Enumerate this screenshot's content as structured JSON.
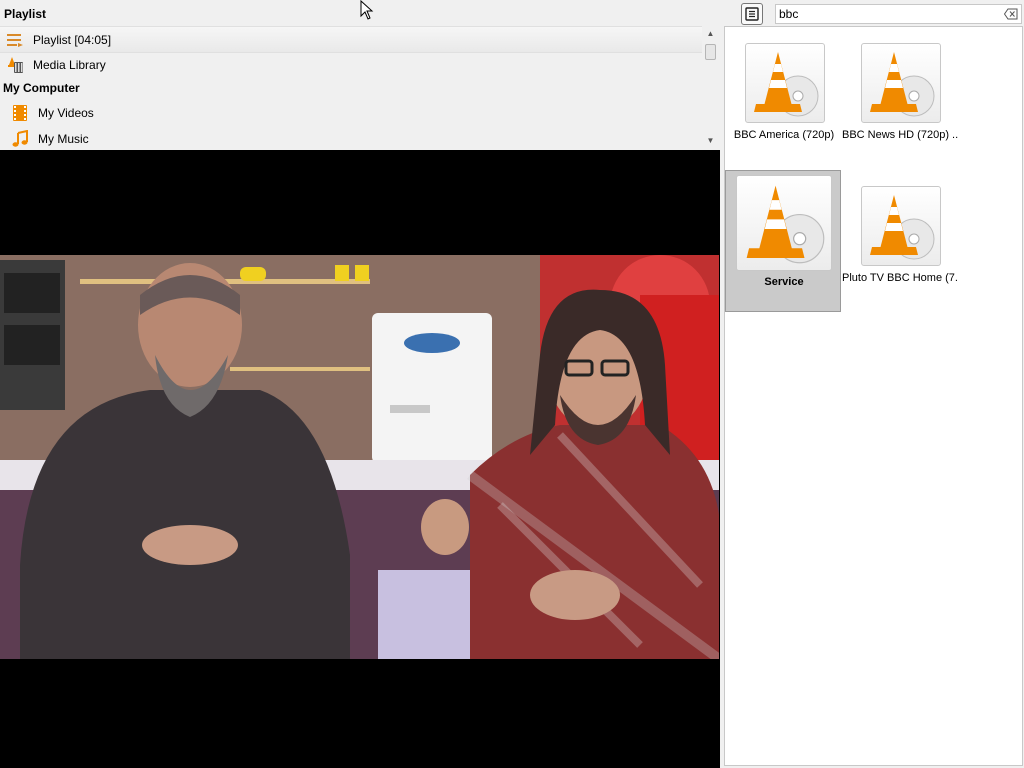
{
  "playlist": {
    "header": "Playlist",
    "items": [
      {
        "label": "Playlist [04:05]",
        "icon": "playlist-icon"
      },
      {
        "label": "Media Library",
        "icon": "media-library-icon"
      }
    ],
    "section_my_computer": "My Computer",
    "computer_items": [
      {
        "label": "My Videos",
        "icon": "film-icon"
      },
      {
        "label": "My Music",
        "icon": "music-note-icon"
      }
    ]
  },
  "search": {
    "value": "bbc",
    "toggle_icon": "list-view-icon",
    "clear_icon": "clear-search-icon"
  },
  "results": [
    {
      "label": "BBC America (720p)",
      "icon": "vlc-cone-icon",
      "selected": false
    },
    {
      "label": "BBC News HD (720p) ...",
      "icon": "vlc-cone-icon",
      "selected": false
    },
    {
      "label": "Service",
      "icon": "vlc-cone-icon",
      "selected": true
    },
    {
      "label": "Pluto TV BBC Home (7...",
      "icon": "vlc-cone-icon",
      "selected": false
    }
  ],
  "colors": {
    "accent_orange": "#f08a00",
    "selection": "#cacaca"
  }
}
